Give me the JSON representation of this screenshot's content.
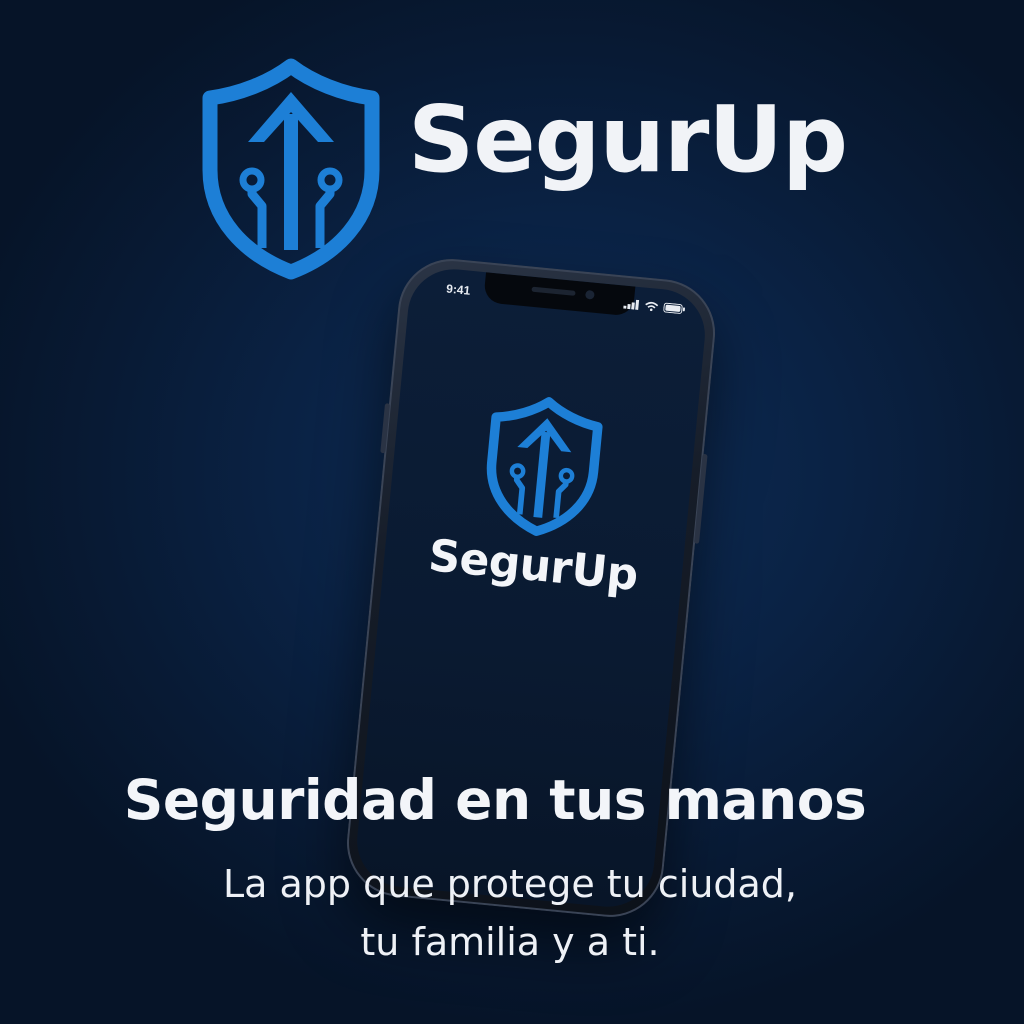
{
  "brand": {
    "name": "SegurUp",
    "logo_icon": "shield-arrow-circuit-icon"
  },
  "phone": {
    "status_time": "9:41",
    "status_icons": [
      "signal-icon",
      "wifi-icon",
      "battery-icon"
    ],
    "screen_app_name": "SegurUp",
    "screen_logo_icon": "shield-arrow-circuit-icon"
  },
  "tagline": {
    "headline": "Seguridad en tus manos",
    "subline_1": "La app que protege tu ciudad,",
    "subline_2": "tu familia y a ti."
  },
  "colors": {
    "background": "#0a2244",
    "brand_blue": "#1d7fd6",
    "text": "#f3f5f9"
  }
}
